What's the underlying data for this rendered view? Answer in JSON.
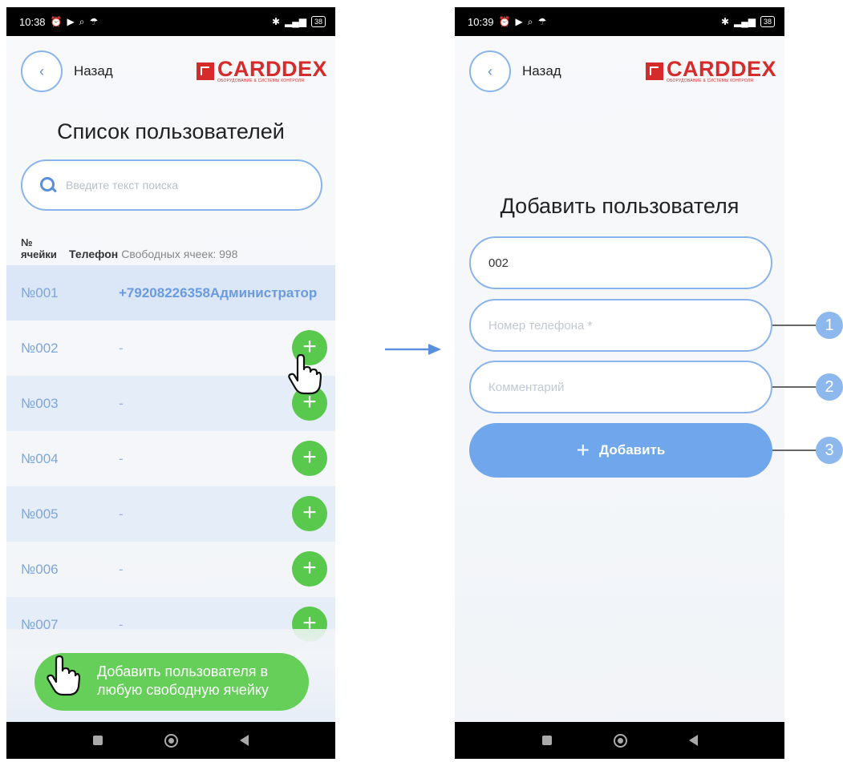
{
  "left_screen": {
    "status": {
      "time": "10:38",
      "battery": "38"
    },
    "header": {
      "back_label": "Назад",
      "logo_text": "CARDDEX",
      "logo_tagline": "ОБОРУДОВАНИЕ & СИСТЕМЫ КОНТРОЛЯ"
    },
    "title": "Список пользователей",
    "search": {
      "placeholder": "Введите текст поиска"
    },
    "table": {
      "col_cell": "№ ячейки",
      "col_phone": "Телефон",
      "free_cells": "Свободных ячеек: 998",
      "rows": [
        {
          "cell": "№001",
          "phone": "+79208226358Администратор"
        },
        {
          "cell": "№002",
          "phone": "-"
        },
        {
          "cell": "№003",
          "phone": "-"
        },
        {
          "cell": "№004",
          "phone": "-"
        },
        {
          "cell": "№005",
          "phone": "-"
        },
        {
          "cell": "№006",
          "phone": "-"
        },
        {
          "cell": "№007",
          "phone": "-"
        }
      ]
    },
    "bulk_add_label": "Добавить пользователя в любую свободную ячейку"
  },
  "right_screen": {
    "status": {
      "time": "10:39",
      "battery": "38"
    },
    "header": {
      "back_label": "Назад",
      "logo_text": "CARDDEX",
      "logo_tagline": "ОБОРУДОВАНИЕ & СИСТЕМЫ КОНТРОЛЯ"
    },
    "title": "Добавить пользователя",
    "form": {
      "cell_value": "002",
      "phone_placeholder": "Номер телефона *",
      "comment_placeholder": "Комментарий",
      "submit_label": "Добавить"
    },
    "callouts": [
      "1",
      "2",
      "3"
    ]
  },
  "colors": {
    "accent_blue": "#8ab4ec",
    "button_blue": "#6fa6ec",
    "add_green": "#59c94e",
    "brand_red": "#d62b2b"
  },
  "icons": [
    "back-chevron-icon",
    "search-icon",
    "plus-icon",
    "hand-pointer-icon",
    "arrow-right-icon"
  ]
}
